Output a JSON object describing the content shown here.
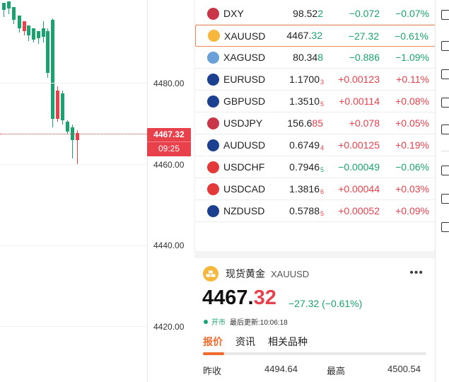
{
  "chart": {
    "price_ticks": [
      "4480.00",
      "4460.00",
      "4440.00",
      "4420.00"
    ],
    "current_price": "4467.32",
    "current_time": "09:25"
  },
  "watchlist": [
    {
      "symbol": "DXY",
      "last_main": "98.52",
      "last_tail": "2",
      "last_sub": "",
      "change": "−0.072",
      "pct": "−0.07%",
      "dir": "down",
      "selected": false,
      "icon": "us-flag-icon"
    },
    {
      "symbol": "XAUUSD",
      "last_main": "4467.",
      "last_tail": "32",
      "last_sub": "",
      "change": "−27.32",
      "pct": "−0.61%",
      "dir": "down",
      "selected": true,
      "icon": "gold-icon"
    },
    {
      "symbol": "XAGUSD",
      "last_main": "80.34",
      "last_tail": "8",
      "last_sub": "",
      "change": "−0.886",
      "pct": "−1.09%",
      "dir": "down",
      "selected": false,
      "icon": "silver-icon"
    },
    {
      "symbol": "EURUSD",
      "last_main": "1.1700",
      "last_tail": "",
      "last_sub": "3",
      "change": "+0.00123",
      "pct": "+0.11%",
      "dir": "up",
      "selected": false,
      "icon": "eu-flag-icon"
    },
    {
      "symbol": "GBPUSD",
      "last_main": "1.3510",
      "last_tail": "",
      "last_sub": "5",
      "change": "+0.00114",
      "pct": "+0.08%",
      "dir": "up",
      "selected": false,
      "icon": "uk-flag-icon"
    },
    {
      "symbol": "USDJPY",
      "last_main": "156.6",
      "last_tail": "85",
      "last_sub": "",
      "change": "+0.078",
      "pct": "+0.05%",
      "dir": "up",
      "selected": false,
      "icon": "us-flag-icon"
    },
    {
      "symbol": "AUDUSD",
      "last_main": "0.6749",
      "last_tail": "",
      "last_sub": "4",
      "change": "+0.00125",
      "pct": "+0.19%",
      "dir": "up",
      "selected": false,
      "icon": "au-flag-icon"
    },
    {
      "symbol": "USDCHF",
      "last_main": "0.7946",
      "last_tail": "",
      "last_sub": "5",
      "change": "−0.00049",
      "pct": "−0.06%",
      "dir": "down",
      "selected": false,
      "icon": "ch-flag-icon"
    },
    {
      "symbol": "USDCAD",
      "last_main": "1.3816",
      "last_tail": "",
      "last_sub": "6",
      "change": "+0.00044",
      "pct": "+0.03%",
      "dir": "up",
      "selected": false,
      "icon": "ca-flag-icon"
    },
    {
      "symbol": "NZDUSD",
      "last_main": "0.5788",
      "last_tail": "",
      "last_sub": "5",
      "change": "+0.00052",
      "pct": "+0.09%",
      "dir": "up",
      "selected": false,
      "icon": "nz-flag-icon"
    }
  ],
  "detail": {
    "name": "现货黄金",
    "code": "XAUUSD",
    "more": "•••",
    "price_main": "4467.",
    "price_dec": "32",
    "change_text": "−27.32 (−0.61%)",
    "market_status": "开市",
    "updated": "最后更新:10:06:18",
    "tabs": [
      "报价",
      "资讯",
      "相关品种"
    ],
    "stats": [
      {
        "label": "昨收",
        "value": "4494.64"
      },
      {
        "label": "最高",
        "value": "4500.54"
      }
    ]
  },
  "colors": {
    "up": "#e8414c",
    "down": "#1aa36f",
    "accent": "#ef6a2d",
    "gold": "#f6b73c"
  }
}
